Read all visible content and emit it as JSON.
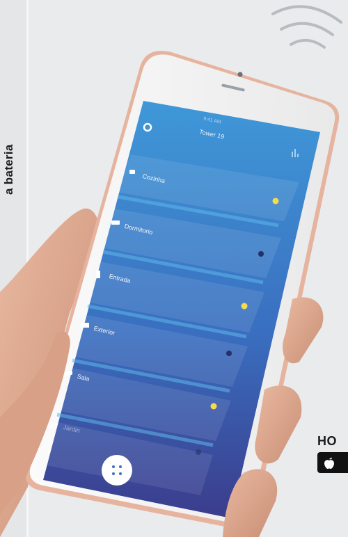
{
  "side_caption": "a bateria",
  "corner_caption": "HO",
  "store_badge": {
    "icon": "apple-icon"
  },
  "app": {
    "status_time": "9:41 AM",
    "title": "Tower 19",
    "rooms": [
      {
        "label": "Cozinha",
        "icon": "cup-icon",
        "light_on": true
      },
      {
        "label": "Dormitorio",
        "icon": "bed-icon",
        "light_on": false
      },
      {
        "label": "Entrada",
        "icon": "door-icon",
        "light_on": true
      },
      {
        "label": "Exterior",
        "icon": "fence-icon",
        "light_on": false
      },
      {
        "label": "Sala",
        "icon": "sofa-icon",
        "light_on": true
      },
      {
        "label": "Jardin",
        "icon": "garden-icon",
        "light_on": false
      }
    ]
  },
  "colors": {
    "screen_top": "#3f98d8",
    "screen_bottom": "#3b3c8c",
    "bulb_on": "#f5dc4a",
    "bulb_off": "#25306a",
    "phone_frame": "#f3f3f4",
    "phone_edge": "#e6b49e"
  }
}
